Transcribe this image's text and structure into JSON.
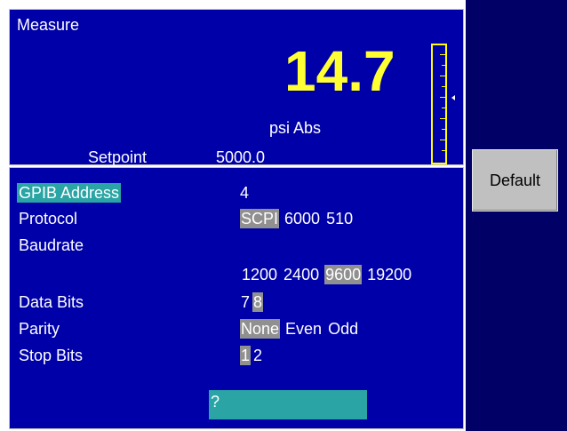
{
  "measure": {
    "title": "Measure",
    "reading": "14.7",
    "unit": "psi Abs",
    "setpoint_label": "Setpoint",
    "setpoint_value": "5000.0"
  },
  "settings": {
    "rows": [
      {
        "label": "GPIB Address",
        "selected": true
      },
      {
        "label": "Protocol"
      },
      {
        "label": "Baudrate"
      },
      {
        "label": "Data Bits"
      },
      {
        "label": "Parity"
      },
      {
        "label": "Stop Bits"
      }
    ],
    "gpib_address_value": "4",
    "protocol_options": [
      {
        "label": "SCPI",
        "active": true
      },
      {
        "label": "6000",
        "active": false
      },
      {
        "label": "510",
        "active": false
      }
    ],
    "baudrate_options": [
      {
        "label": "1200",
        "active": false
      },
      {
        "label": "2400",
        "active": false
      },
      {
        "label": "9600",
        "active": true
      },
      {
        "label": "19200",
        "active": false
      }
    ],
    "data_bits_options": [
      {
        "label": "7",
        "active": false
      },
      {
        "label": "8",
        "active": true
      }
    ],
    "parity_options": [
      {
        "label": "None",
        "active": true
      },
      {
        "label": "Even",
        "active": false
      },
      {
        "label": "Odd",
        "active": false
      }
    ],
    "stop_bits_options": [
      {
        "label": "1",
        "active": true
      },
      {
        "label": "2",
        "active": false
      }
    ],
    "input_value": "?"
  },
  "buttons": {
    "default_label": "Default"
  },
  "colors": {
    "panel_bg": "#0000a8",
    "right_bg": "#000066",
    "reading": "#ffff33",
    "highlight": "#2aa4a4",
    "active_option": "#909090"
  }
}
